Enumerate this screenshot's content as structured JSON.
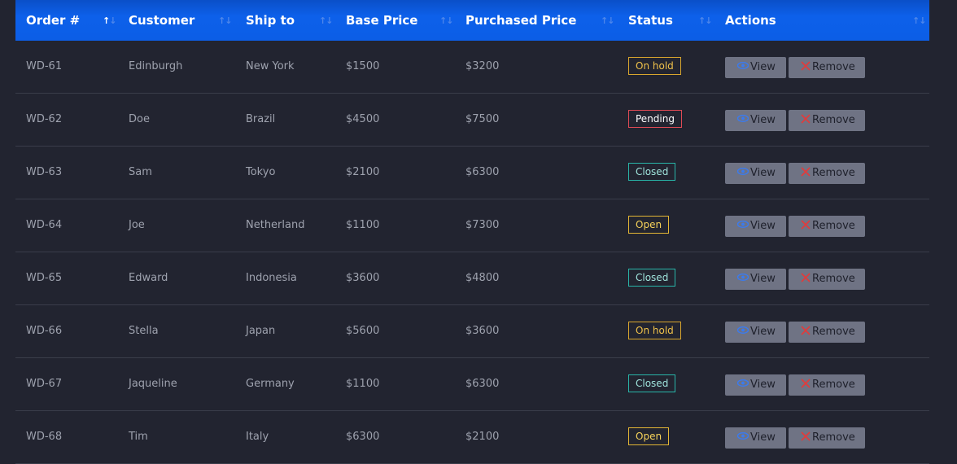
{
  "colors": {
    "header_bg": "#0c5ee6",
    "body_bg": "#222430",
    "row_text": "#9ea2ae",
    "button_bg": "#6f7384",
    "view_icon": "#3a7bf0",
    "remove_icon": "#e23b3b"
  },
  "columns": [
    {
      "label": "Order #",
      "sort_icon": "sort-icon",
      "sort_active": "asc"
    },
    {
      "label": "Customer",
      "sort_icon": "sort-icon"
    },
    {
      "label": "Ship to",
      "sort_icon": "sort-icon"
    },
    {
      "label": "Base Price",
      "sort_icon": "sort-icon"
    },
    {
      "label": "Purchased Price",
      "sort_icon": "sort-icon"
    },
    {
      "label": "Status",
      "sort_icon": "sort-icon"
    },
    {
      "label": "Actions",
      "sort_icon": "sort-icon"
    }
  ],
  "actions": {
    "view_label": "View",
    "view_icon": "eye-icon",
    "remove_label": "Remove",
    "remove_icon": "x-icon"
  },
  "rows": [
    {
      "order": "WD-61",
      "customer": "Edinburgh",
      "ship_to": "New York",
      "base_price": "$1500",
      "purchased_price": "$3200",
      "status": "On hold",
      "status_kind": "onhold"
    },
    {
      "order": "WD-62",
      "customer": "Doe",
      "ship_to": "Brazil",
      "base_price": "$4500",
      "purchased_price": "$7500",
      "status": "Pending",
      "status_kind": "pending"
    },
    {
      "order": "WD-63",
      "customer": "Sam",
      "ship_to": "Tokyo",
      "base_price": "$2100",
      "purchased_price": "$6300",
      "status": "Closed",
      "status_kind": "closed"
    },
    {
      "order": "WD-64",
      "customer": "Joe",
      "ship_to": "Netherland",
      "base_price": "$1100",
      "purchased_price": "$7300",
      "status": "Open",
      "status_kind": "open"
    },
    {
      "order": "WD-65",
      "customer": "Edward",
      "ship_to": "Indonesia",
      "base_price": "$3600",
      "purchased_price": "$4800",
      "status": "Closed",
      "status_kind": "closed"
    },
    {
      "order": "WD-66",
      "customer": "Stella",
      "ship_to": "Japan",
      "base_price": "$5600",
      "purchased_price": "$3600",
      "status": "On hold",
      "status_kind": "onhold"
    },
    {
      "order": "WD-67",
      "customer": "Jaqueline",
      "ship_to": "Germany",
      "base_price": "$1100",
      "purchased_price": "$6300",
      "status": "Closed",
      "status_kind": "closed"
    },
    {
      "order": "WD-68",
      "customer": "Tim",
      "ship_to": "Italy",
      "base_price": "$6300",
      "purchased_price": "$2100",
      "status": "Open",
      "status_kind": "open"
    }
  ]
}
